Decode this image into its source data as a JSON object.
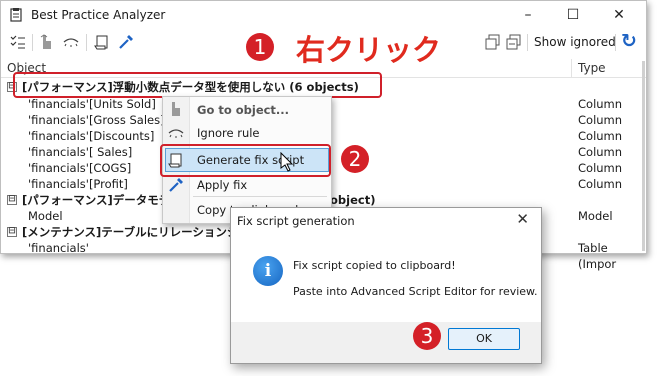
{
  "window": {
    "title": "Best Practice Analyzer",
    "minimize": "–",
    "maximize": "☐",
    "close": "✕"
  },
  "toolbar": {
    "show_ignored_label": "Show ignored",
    "refresh_icon": "↻"
  },
  "grid": {
    "columns": [
      "Object",
      "Type"
    ],
    "rows": [
      {
        "kind": "group",
        "toggle": "⊟",
        "text": "[パフォーマンス]浮動小数点データ型を使用しない (6 objects)",
        "type": ""
      },
      {
        "kind": "item",
        "text": "'financials'[Units Sold]",
        "type": "Column"
      },
      {
        "kind": "item",
        "text": "'financials'[Gross Sales]",
        "type": "Column"
      },
      {
        "kind": "item",
        "text": "'financials'[Discounts]",
        "type": "Column"
      },
      {
        "kind": "item",
        "text": "'financials'[ Sales]",
        "type": "Column"
      },
      {
        "kind": "item",
        "text": "'financials'[COGS]",
        "type": "Column"
      },
      {
        "kind": "item",
        "text": "'financials'[Profit]",
        "type": "Column"
      },
      {
        "kind": "group",
        "toggle": "⊟",
        "text": "[パフォーマンス]データモデ",
        "tail": "object)",
        "type": ""
      },
      {
        "kind": "item",
        "text": "Model",
        "type": "Model"
      },
      {
        "kind": "group",
        "toggle": "⊟",
        "text": "[メンテナンス]テーブルにリレーションシッ",
        "type": ""
      },
      {
        "kind": "item",
        "text": "'financials'",
        "type": "Table (Impor"
      }
    ]
  },
  "context_menu": {
    "items": [
      "Go to object...",
      "Ignore rule",
      "Generate fix script",
      "Apply fix",
      "Copy to clipboard"
    ]
  },
  "callouts": {
    "step1": "1",
    "step1_text": "右クリック",
    "step2": "2",
    "step3": "3"
  },
  "dialog": {
    "title": "Fix script generation",
    "close": "✕",
    "message_line1": "Fix script copied to clipboard!",
    "message_line2": "Paste into Advanced Script Editor for review.",
    "ok_label": "OK"
  },
  "colors": {
    "accent_red": "#d42027",
    "selection_blue": "#cce4f7",
    "button_blue": "#0078d4"
  }
}
